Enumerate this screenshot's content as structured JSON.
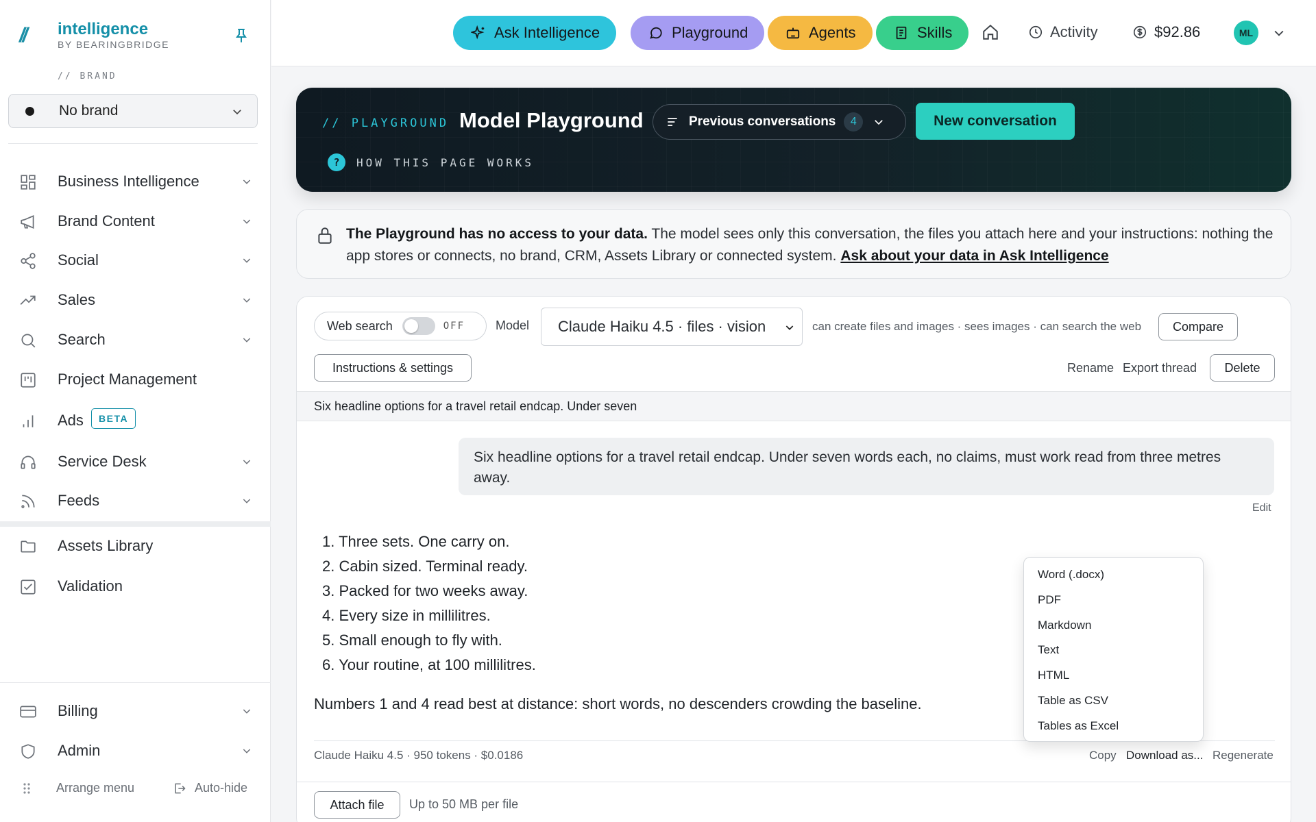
{
  "app": {
    "name": "intelligence",
    "sub": "BY BEARINGBRIDGE",
    "logo_mark": "//"
  },
  "brand": {
    "label": "// BRAND",
    "selected": "No brand"
  },
  "sidebar": {
    "items": [
      {
        "label": "Business Intelligence",
        "icon": "grid-icon"
      },
      {
        "label": "Brand Content",
        "icon": "megaphone-icon"
      },
      {
        "label": "Social",
        "icon": "share-icon"
      },
      {
        "label": "Sales",
        "icon": "trend-icon"
      },
      {
        "label": "Search",
        "icon": "search-icon"
      },
      {
        "label": "Project Management",
        "icon": "kanban-icon"
      },
      {
        "label": "Ads",
        "icon": "bar-chart-icon",
        "badge": "BETA"
      },
      {
        "label": "Service Desk",
        "icon": "headset-icon"
      },
      {
        "label": "Feeds",
        "icon": "rss-icon"
      },
      {
        "label": "Assets Library",
        "icon": "folder-icon"
      },
      {
        "label": "Validation",
        "icon": "checkbox-icon"
      }
    ],
    "bottom_items": [
      {
        "label": "Billing",
        "icon": "card-icon"
      },
      {
        "label": "Admin",
        "icon": "shield-icon"
      }
    ],
    "arrange_menu": "Arrange menu",
    "auto_hide": "Auto-hide"
  },
  "topbar": {
    "ask": "Ask Intelligence",
    "playground": "Playground",
    "agents": "Agents",
    "skills": "Skills",
    "activity": "Activity",
    "balance": "$92.86",
    "avatar": "ML",
    "colors": {
      "ask": "#2ec4dc",
      "playground": "#a59cf2",
      "agents": "#f5b942",
      "skills": "#38cf8c"
    }
  },
  "hero": {
    "kicker": "// PLAYGROUND",
    "title": "Model Playground",
    "previous": "Previous conversations",
    "previous_count": "4",
    "new_conversation": "New conversation",
    "how": "HOW THIS PAGE WORKS"
  },
  "notice": {
    "bold": "The Playground has no access to your data.",
    "body": " The model sees only this conversation, the files you attach here and your instructions: nothing the app stores or connects, no brand, CRM, Assets Library or connected system. ",
    "link": "Ask about your data in Ask Intelligence"
  },
  "controls": {
    "web_search": "Web search",
    "web_search_state": "OFF",
    "model_label": "Model",
    "model_value": "Claude Haiku 4.5 · files · vision",
    "capabilities": "can create files and images · sees images · can search the web",
    "compare": "Compare",
    "instructions": "Instructions & settings",
    "rename": "Rename",
    "export": "Export thread",
    "delete": "Delete"
  },
  "thread": {
    "title": "Six headline options for a travel retail endcap. Under seven",
    "user_message": "Six headline options for a travel retail endcap. Under seven words each, no claims, must work read from three metres away.",
    "edit": "Edit",
    "answer": [
      "1. Three sets. One carry on.",
      "2. Cabin sized. Terminal ready.",
      "3. Packed for two weeks away.",
      "4. Every size in millilitres.",
      "5. Small enough to fly with.",
      "6. Your routine, at 100 millilitres."
    ],
    "note": "Numbers 1 and 4 read best at distance: short words, no descenders crowding the baseline.",
    "meta": "Claude Haiku 4.5 · 950 tokens · $0.0186",
    "copy": "Copy",
    "download": "Download as...",
    "regenerate": "Regenerate"
  },
  "download_menu": [
    "Word (.docx)",
    "PDF",
    "Markdown",
    "Text",
    "HTML",
    "Table as CSV",
    "Tables as Excel"
  ],
  "composer": {
    "attach": "Attach file",
    "hint": "Up to 50 MB per file"
  }
}
